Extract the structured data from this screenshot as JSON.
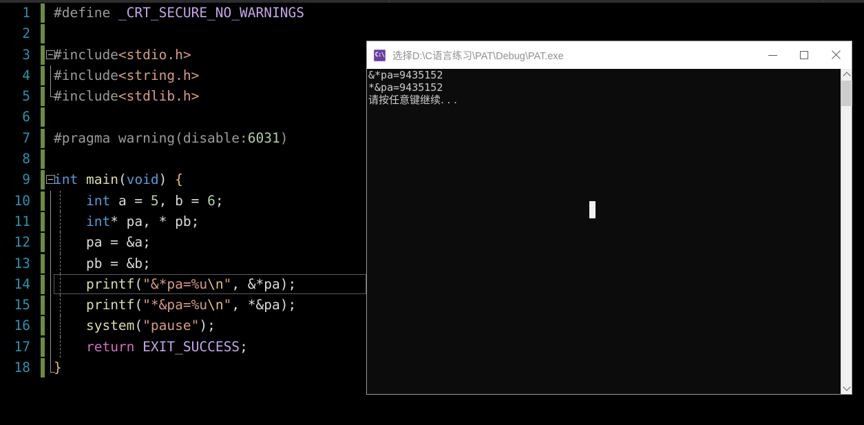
{
  "window_title_strip": {
    "segments": 3
  },
  "editor": {
    "language": "c",
    "theme": "dark",
    "current_line": 14,
    "lines": [
      {
        "n": "1",
        "tokens": [
          {
            "t": "#define ",
            "c": "t-pp"
          },
          {
            "t": "_CRT_SECURE_NO_WARNINGS",
            "c": "t-macro"
          }
        ]
      },
      {
        "n": "2",
        "tokens": []
      },
      {
        "n": "3",
        "tokens": [
          {
            "t": "#include",
            "c": "t-pp"
          },
          {
            "t": "<stdio.h>",
            "c": "t-header"
          }
        ]
      },
      {
        "n": "4",
        "tokens": [
          {
            "t": "#include",
            "c": "t-pp"
          },
          {
            "t": "<string.h>",
            "c": "t-header"
          }
        ]
      },
      {
        "n": "5",
        "tokens": [
          {
            "t": "#include",
            "c": "t-pp"
          },
          {
            "t": "<stdlib.h>",
            "c": "t-header"
          }
        ]
      },
      {
        "n": "6",
        "tokens": []
      },
      {
        "n": "7",
        "tokens": [
          {
            "t": "#pragma warning(disable:",
            "c": "t-pp"
          },
          {
            "t": "6031",
            "c": "t-num"
          },
          {
            "t": ")",
            "c": "t-pp"
          }
        ]
      },
      {
        "n": "8",
        "tokens": []
      },
      {
        "n": "9",
        "tokens": [
          {
            "t": "int",
            "c": "t-kw"
          },
          {
            "t": " ",
            "c": "t-plain"
          },
          {
            "t": "main",
            "c": "t-fn"
          },
          {
            "t": "(",
            "c": "t-plain"
          },
          {
            "t": "void",
            "c": "t-kw"
          },
          {
            "t": ") ",
            "c": "t-plain"
          },
          {
            "t": "{",
            "c": "t-brace"
          }
        ]
      },
      {
        "n": "10",
        "tokens": [
          {
            "t": "    ",
            "c": "t-plain"
          },
          {
            "t": "int",
            "c": "t-kw"
          },
          {
            "t": " a = ",
            "c": "t-plain"
          },
          {
            "t": "5",
            "c": "t-num"
          },
          {
            "t": ", b = ",
            "c": "t-plain"
          },
          {
            "t": "6",
            "c": "t-num"
          },
          {
            "t": ";",
            "c": "t-plain"
          }
        ]
      },
      {
        "n": "11",
        "tokens": [
          {
            "t": "    ",
            "c": "t-plain"
          },
          {
            "t": "int",
            "c": "t-kw"
          },
          {
            "t": "* pa, * pb;",
            "c": "t-plain"
          }
        ]
      },
      {
        "n": "12",
        "tokens": [
          {
            "t": "    pa = &a;",
            "c": "t-plain"
          }
        ]
      },
      {
        "n": "13",
        "tokens": [
          {
            "t": "    pb = &b;",
            "c": "t-plain"
          }
        ]
      },
      {
        "n": "14",
        "tokens": [
          {
            "t": "    ",
            "c": "t-plain"
          },
          {
            "t": "printf",
            "c": "t-fn"
          },
          {
            "t": "(",
            "c": "t-plain"
          },
          {
            "t": "\"&*pa=%u",
            "c": "t-str"
          },
          {
            "t": "\\n",
            "c": "t-esc"
          },
          {
            "t": "\"",
            "c": "t-str"
          },
          {
            "t": ", &*pa);",
            "c": "t-plain"
          }
        ]
      },
      {
        "n": "15",
        "tokens": [
          {
            "t": "    ",
            "c": "t-plain"
          },
          {
            "t": "printf",
            "c": "t-fn"
          },
          {
            "t": "(",
            "c": "t-plain"
          },
          {
            "t": "\"*&pa=%u",
            "c": "t-str"
          },
          {
            "t": "\\n",
            "c": "t-esc"
          },
          {
            "t": "\"",
            "c": "t-str"
          },
          {
            "t": ", *&pa);",
            "c": "t-plain"
          }
        ]
      },
      {
        "n": "16",
        "tokens": [
          {
            "t": "    ",
            "c": "t-plain"
          },
          {
            "t": "system",
            "c": "t-fn"
          },
          {
            "t": "(",
            "c": "t-plain"
          },
          {
            "t": "\"pause\"",
            "c": "t-str"
          },
          {
            "t": ");",
            "c": "t-plain"
          }
        ]
      },
      {
        "n": "17",
        "tokens": [
          {
            "t": "    ",
            "c": "t-plain"
          },
          {
            "t": "return",
            "c": "t-ctrl"
          },
          {
            "t": " ",
            "c": "t-plain"
          },
          {
            "t": "EXIT_SUCCESS",
            "c": "t-const"
          },
          {
            "t": ";",
            "c": "t-plain"
          }
        ]
      },
      {
        "n": "18",
        "tokens": [
          {
            "t": "}",
            "c": "t-brace"
          }
        ]
      }
    ]
  },
  "console": {
    "title": "选择D:\\C语言练习\\PAT\\Debug\\PAT.exe",
    "app_icon_label": "C:\\",
    "buttons": {
      "minimize": "−",
      "maximize": "□",
      "close": "✕"
    },
    "output_lines": [
      "&*pa=9435152",
      "*&pa=9435152",
      "请按任意键继续. . ."
    ],
    "scrollbar": {
      "up": "▲",
      "down": "▼"
    }
  },
  "colors": {
    "editor_bg": "#000000",
    "line_number": "#2B91AF",
    "change_bar": "#6f8b3e",
    "keyword": "#569CD6",
    "function": "#DCDCAA",
    "string": "#D69D85",
    "number": "#B5CEA8",
    "macro": "#C5A5E8",
    "preprocessor": "#9B9B9B",
    "console_bg": "#0c0c0c",
    "console_fg": "#cccccc",
    "titlebar_bg": "#ffffff"
  }
}
